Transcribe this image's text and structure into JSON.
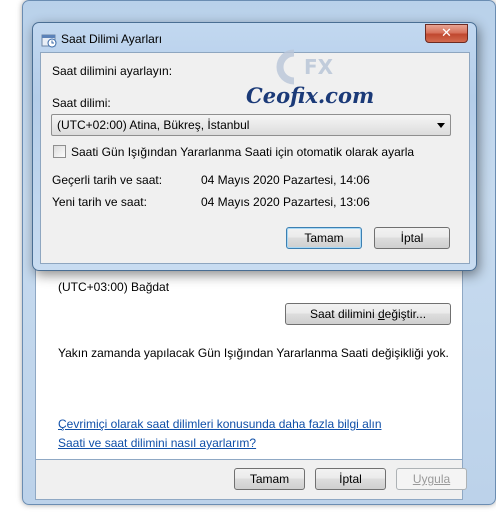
{
  "back_window": {
    "current_zone": "(UTC+03:00) Bağdat",
    "change_zone_button": {
      "pre": "Saat dilimini ",
      "accel": "d",
      "post": "eğiştir..."
    },
    "dst_notice": "Yakın zamanda yapılacak Gün Işığından Yararlanma Saati değişikliği yok.",
    "link_more_info": "Çevrimiçi olarak saat dilimleri konusunda daha fazla bilgi alın",
    "link_how_to": "Saati ve saat dilimini nasıl ayarlarım?",
    "ok_label": "Tamam",
    "cancel_label": "İptal",
    "apply_label": "Uygula"
  },
  "dialog": {
    "title": "Saat Dilimi Ayarları",
    "close_glyph": "✕",
    "instruction": "Saat dilimini ayarlayın:",
    "timezone_label": "Saat dilimi:",
    "timezone_selected": "(UTC+02:00) Atina, Bükreş, İstanbul",
    "dst_checkbox_label": "Saati Gün Işığından Yararlanma Saati için otomatik olarak ayarla",
    "dst_checked": false,
    "current_datetime_label": "Geçerli tarih ve saat:",
    "current_datetime_value": "04 Mayıs 2020 Pazartesi, 14:06",
    "new_datetime_label": "Yeni tarih ve saat:",
    "new_datetime_value": "04 Mayıs 2020 Pazartesi, 13:06",
    "ok_label": "Tamam",
    "cancel_label": "İptal"
  },
  "watermark": {
    "text": "Ceofix.com",
    "mark_letters": "FX"
  },
  "icons": {
    "title_icon": "time-zone-settings-icon",
    "combo_arrow": "chevron-down-icon",
    "close": "close-icon"
  }
}
